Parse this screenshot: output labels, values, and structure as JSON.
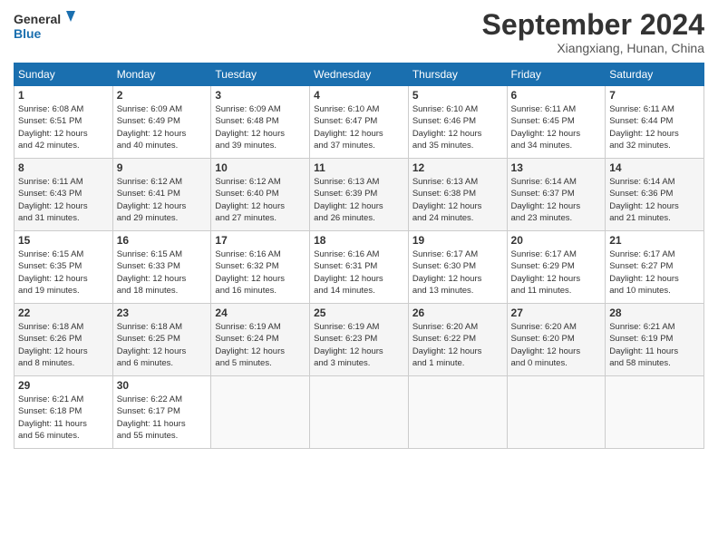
{
  "header": {
    "logo_line1": "General",
    "logo_line2": "Blue",
    "month_title": "September 2024",
    "location": "Xiangxiang, Hunan, China"
  },
  "weekdays": [
    "Sunday",
    "Monday",
    "Tuesday",
    "Wednesday",
    "Thursday",
    "Friday",
    "Saturday"
  ],
  "weeks": [
    [
      {
        "day": "1",
        "info": "Sunrise: 6:08 AM\nSunset: 6:51 PM\nDaylight: 12 hours\nand 42 minutes."
      },
      {
        "day": "2",
        "info": "Sunrise: 6:09 AM\nSunset: 6:49 PM\nDaylight: 12 hours\nand 40 minutes."
      },
      {
        "day": "3",
        "info": "Sunrise: 6:09 AM\nSunset: 6:48 PM\nDaylight: 12 hours\nand 39 minutes."
      },
      {
        "day": "4",
        "info": "Sunrise: 6:10 AM\nSunset: 6:47 PM\nDaylight: 12 hours\nand 37 minutes."
      },
      {
        "day": "5",
        "info": "Sunrise: 6:10 AM\nSunset: 6:46 PM\nDaylight: 12 hours\nand 35 minutes."
      },
      {
        "day": "6",
        "info": "Sunrise: 6:11 AM\nSunset: 6:45 PM\nDaylight: 12 hours\nand 34 minutes."
      },
      {
        "day": "7",
        "info": "Sunrise: 6:11 AM\nSunset: 6:44 PM\nDaylight: 12 hours\nand 32 minutes."
      }
    ],
    [
      {
        "day": "8",
        "info": "Sunrise: 6:11 AM\nSunset: 6:43 PM\nDaylight: 12 hours\nand 31 minutes."
      },
      {
        "day": "9",
        "info": "Sunrise: 6:12 AM\nSunset: 6:41 PM\nDaylight: 12 hours\nand 29 minutes."
      },
      {
        "day": "10",
        "info": "Sunrise: 6:12 AM\nSunset: 6:40 PM\nDaylight: 12 hours\nand 27 minutes."
      },
      {
        "day": "11",
        "info": "Sunrise: 6:13 AM\nSunset: 6:39 PM\nDaylight: 12 hours\nand 26 minutes."
      },
      {
        "day": "12",
        "info": "Sunrise: 6:13 AM\nSunset: 6:38 PM\nDaylight: 12 hours\nand 24 minutes."
      },
      {
        "day": "13",
        "info": "Sunrise: 6:14 AM\nSunset: 6:37 PM\nDaylight: 12 hours\nand 23 minutes."
      },
      {
        "day": "14",
        "info": "Sunrise: 6:14 AM\nSunset: 6:36 PM\nDaylight: 12 hours\nand 21 minutes."
      }
    ],
    [
      {
        "day": "15",
        "info": "Sunrise: 6:15 AM\nSunset: 6:35 PM\nDaylight: 12 hours\nand 19 minutes."
      },
      {
        "day": "16",
        "info": "Sunrise: 6:15 AM\nSunset: 6:33 PM\nDaylight: 12 hours\nand 18 minutes."
      },
      {
        "day": "17",
        "info": "Sunrise: 6:16 AM\nSunset: 6:32 PM\nDaylight: 12 hours\nand 16 minutes."
      },
      {
        "day": "18",
        "info": "Sunrise: 6:16 AM\nSunset: 6:31 PM\nDaylight: 12 hours\nand 14 minutes."
      },
      {
        "day": "19",
        "info": "Sunrise: 6:17 AM\nSunset: 6:30 PM\nDaylight: 12 hours\nand 13 minutes."
      },
      {
        "day": "20",
        "info": "Sunrise: 6:17 AM\nSunset: 6:29 PM\nDaylight: 12 hours\nand 11 minutes."
      },
      {
        "day": "21",
        "info": "Sunrise: 6:17 AM\nSunset: 6:27 PM\nDaylight: 12 hours\nand 10 minutes."
      }
    ],
    [
      {
        "day": "22",
        "info": "Sunrise: 6:18 AM\nSunset: 6:26 PM\nDaylight: 12 hours\nand 8 minutes."
      },
      {
        "day": "23",
        "info": "Sunrise: 6:18 AM\nSunset: 6:25 PM\nDaylight: 12 hours\nand 6 minutes."
      },
      {
        "day": "24",
        "info": "Sunrise: 6:19 AM\nSunset: 6:24 PM\nDaylight: 12 hours\nand 5 minutes."
      },
      {
        "day": "25",
        "info": "Sunrise: 6:19 AM\nSunset: 6:23 PM\nDaylight: 12 hours\nand 3 minutes."
      },
      {
        "day": "26",
        "info": "Sunrise: 6:20 AM\nSunset: 6:22 PM\nDaylight: 12 hours\nand 1 minute."
      },
      {
        "day": "27",
        "info": "Sunrise: 6:20 AM\nSunset: 6:20 PM\nDaylight: 12 hours\nand 0 minutes."
      },
      {
        "day": "28",
        "info": "Sunrise: 6:21 AM\nSunset: 6:19 PM\nDaylight: 11 hours\nand 58 minutes."
      }
    ],
    [
      {
        "day": "29",
        "info": "Sunrise: 6:21 AM\nSunset: 6:18 PM\nDaylight: 11 hours\nand 56 minutes."
      },
      {
        "day": "30",
        "info": "Sunrise: 6:22 AM\nSunset: 6:17 PM\nDaylight: 11 hours\nand 55 minutes."
      },
      {
        "day": "",
        "info": ""
      },
      {
        "day": "",
        "info": ""
      },
      {
        "day": "",
        "info": ""
      },
      {
        "day": "",
        "info": ""
      },
      {
        "day": "",
        "info": ""
      }
    ]
  ]
}
